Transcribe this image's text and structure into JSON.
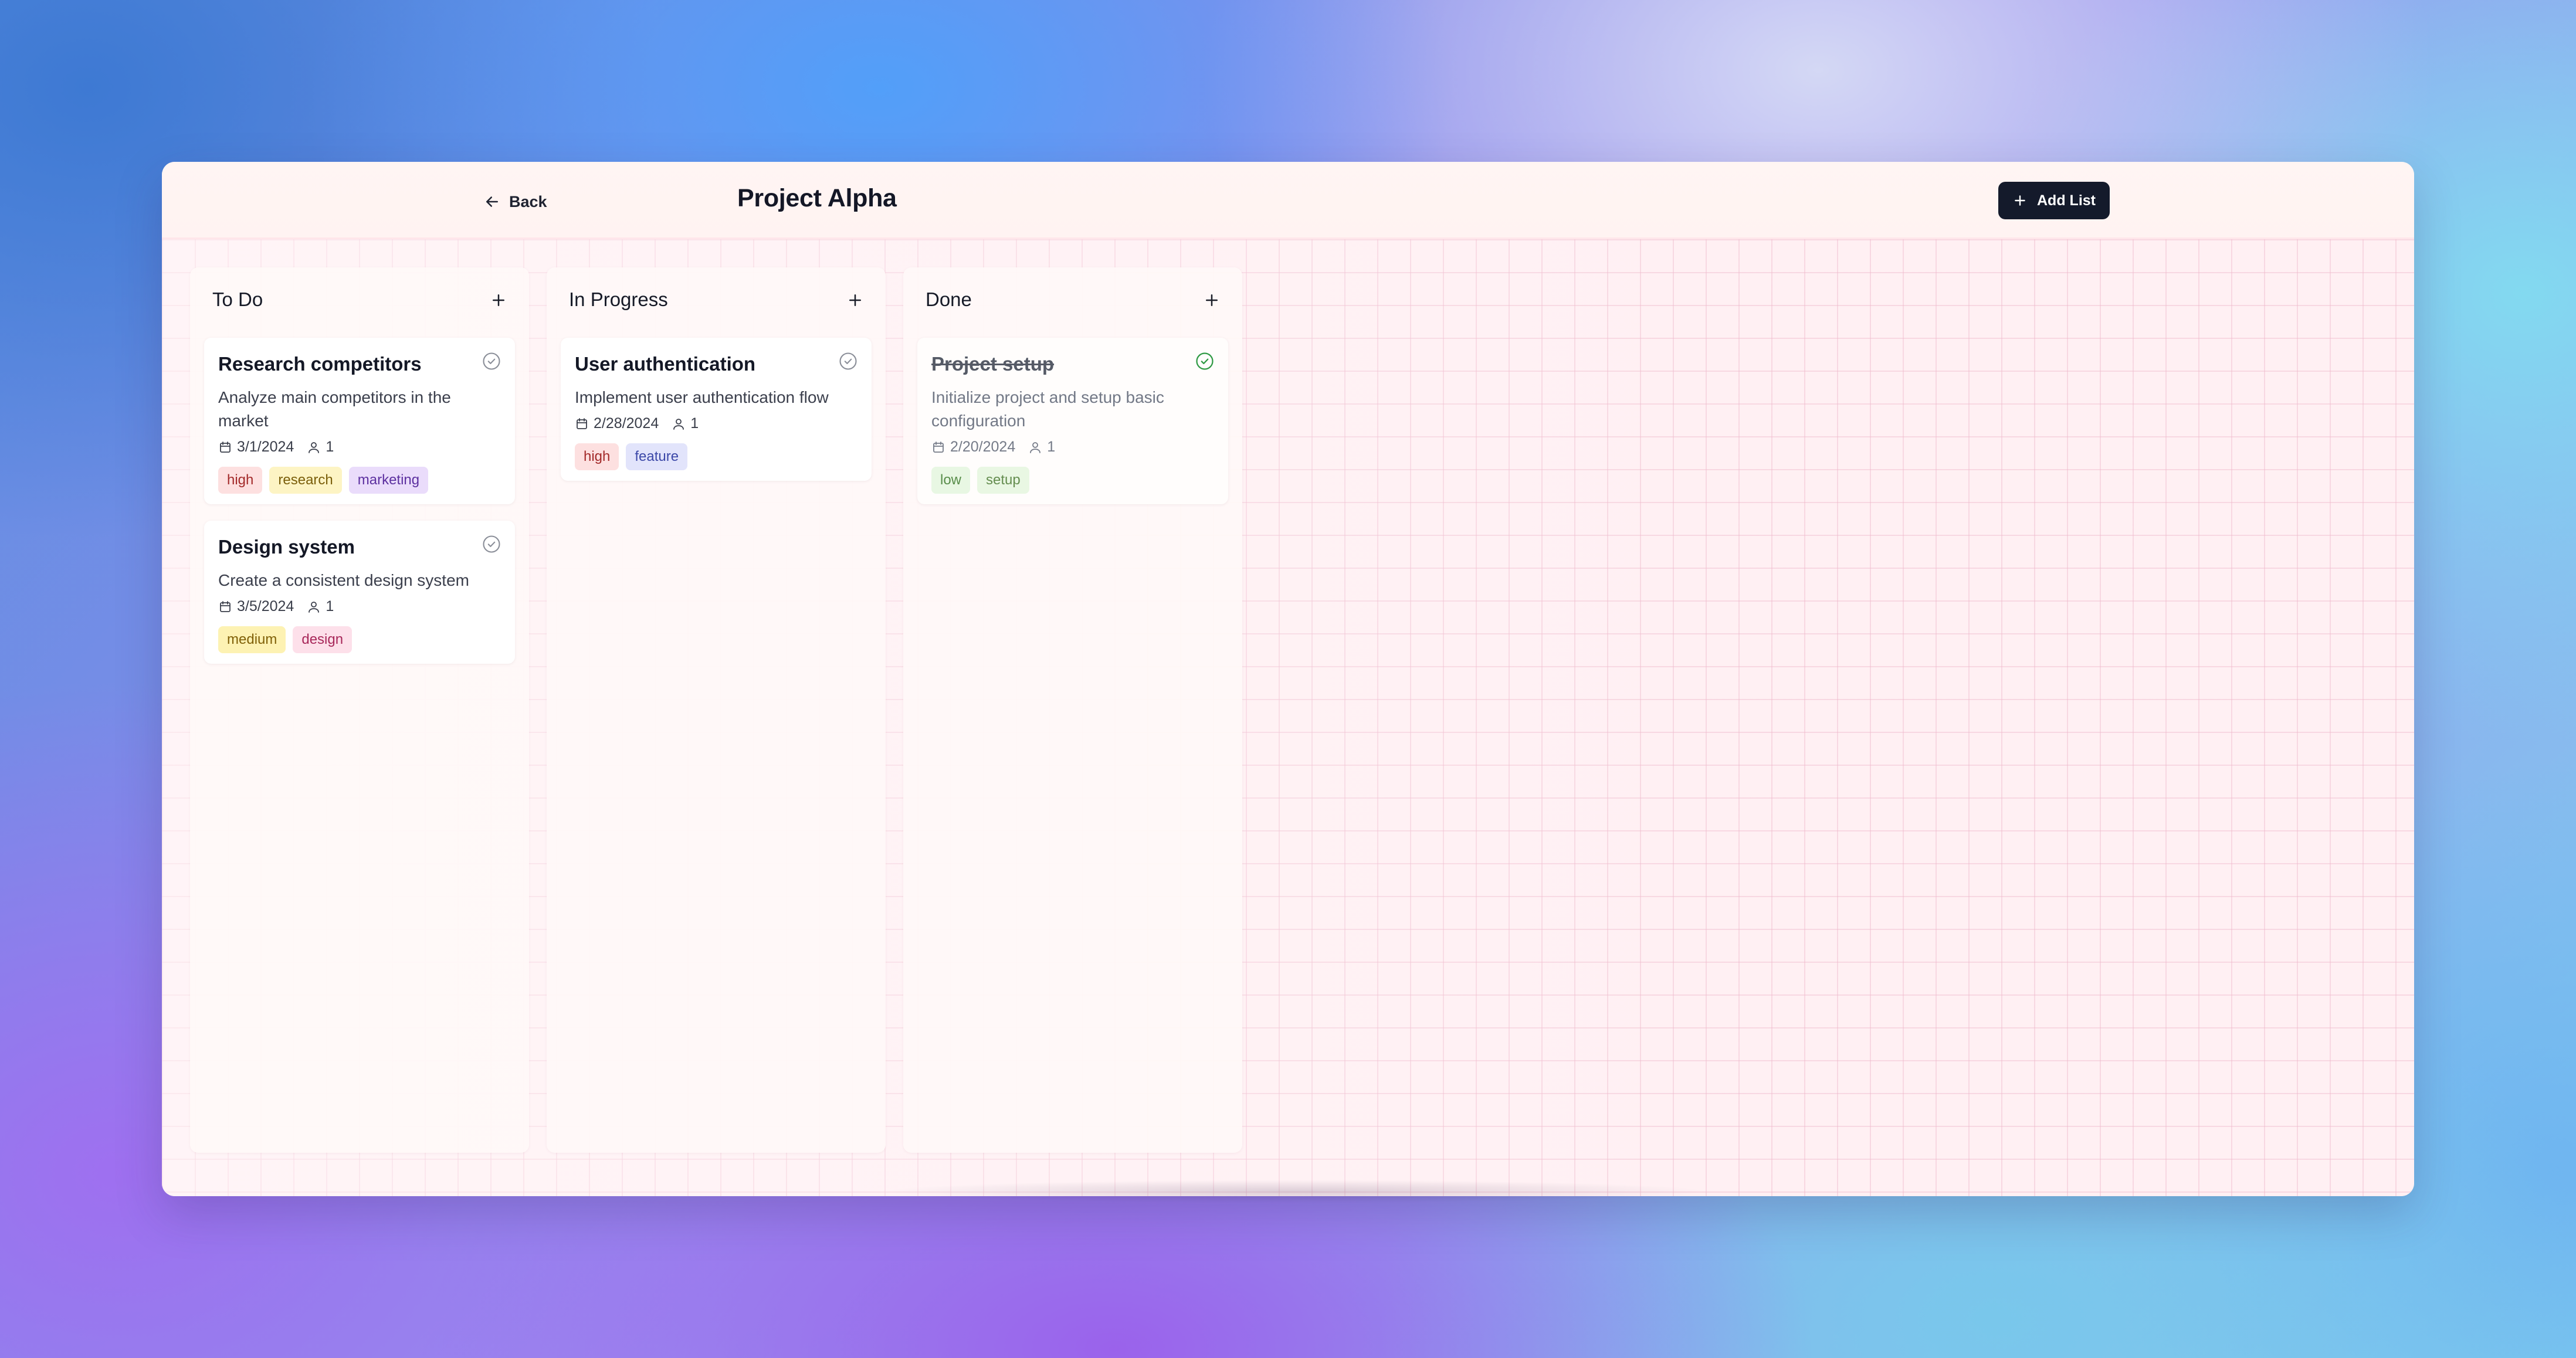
{
  "header": {
    "back_label": "Back",
    "title": "Project Alpha",
    "add_list_label": "Add List"
  },
  "columns": [
    {
      "title": "To Do",
      "cards": [
        {
          "title": "Research competitors",
          "description": "Analyze main competitors in the market",
          "date": "3/1/2024",
          "assignees": "1",
          "completed": false,
          "tags": [
            "high",
            "research",
            "marketing"
          ]
        },
        {
          "title": "Design system",
          "description": "Create a consistent design system",
          "date": "3/5/2024",
          "assignees": "1",
          "completed": false,
          "tags": [
            "medium",
            "design"
          ]
        }
      ]
    },
    {
      "title": "In Progress",
      "cards": [
        {
          "title": "User authentication",
          "description": "Implement user authentication flow",
          "date": "2/28/2024",
          "assignees": "1",
          "completed": false,
          "tags": [
            "high",
            "feature"
          ]
        }
      ]
    },
    {
      "title": "Done",
      "cards": [
        {
          "title": "Project setup",
          "description": "Initialize project and setup basic configuration",
          "date": "2/20/2024",
          "assignees": "1",
          "completed": true,
          "tags": [
            "low",
            "setup"
          ]
        }
      ]
    }
  ],
  "icons": {
    "back": "arrow-left-icon",
    "add_list": "plus-icon",
    "column_add": "plus-icon",
    "check": "check-circle-icon",
    "date": "calendar-icon",
    "assignee": "user-icon"
  },
  "colors": {
    "primary_button": "#141a2b",
    "check_completed": "#2f9a44",
    "check_pending": "#8a8e98"
  }
}
